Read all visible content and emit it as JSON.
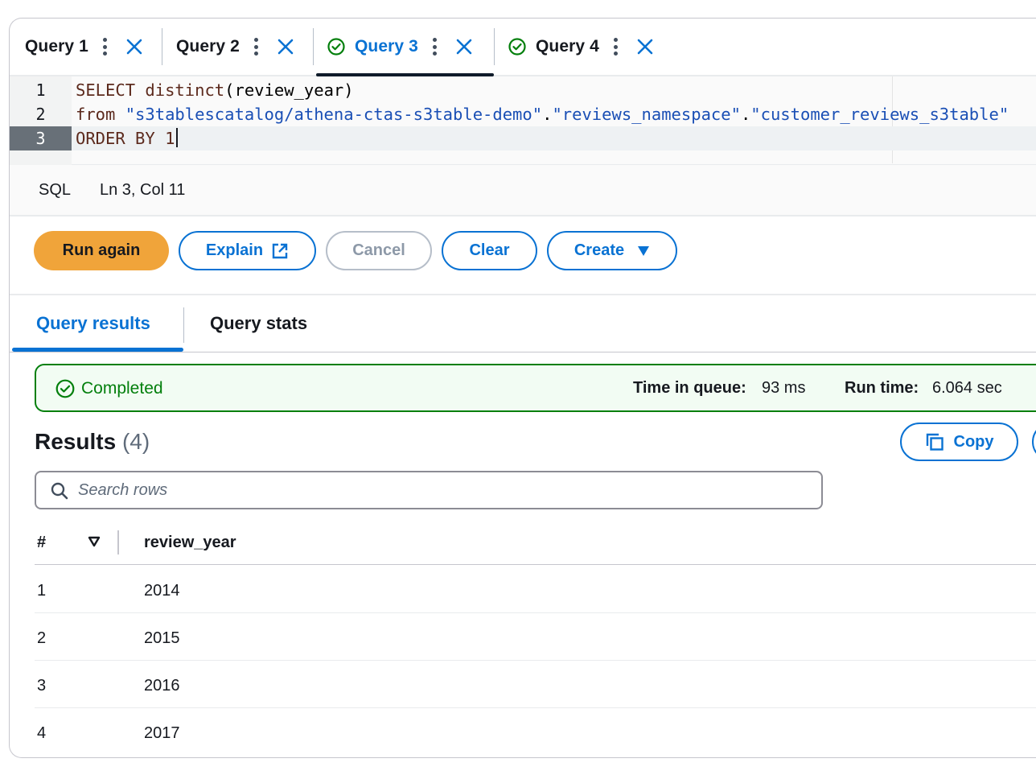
{
  "query_tabs": [
    {
      "label": "Query 1",
      "status": null,
      "active": false
    },
    {
      "label": "Query 2",
      "status": null,
      "active": false
    },
    {
      "label": "Query 3",
      "status": "success",
      "active": true
    },
    {
      "label": "Query 4",
      "status": "success",
      "active": false
    }
  ],
  "editor": {
    "lines": [
      {
        "number": "1",
        "tokens": [
          {
            "t": "SELECT ",
            "c": "kw"
          },
          {
            "t": "distinct",
            "c": "fn"
          },
          {
            "t": "(review_year)",
            "c": "pl"
          }
        ]
      },
      {
        "number": "2",
        "tokens": [
          {
            "t": "from ",
            "c": "kw"
          },
          {
            "t": "\"s3tablescatalog/athena-ctas-s3table-demo\"",
            "c": "str"
          },
          {
            "t": ".",
            "c": "pl"
          },
          {
            "t": "\"reviews_namespace\"",
            "c": "str"
          },
          {
            "t": ".",
            "c": "pl"
          },
          {
            "t": "\"customer_reviews_s3table\"",
            "c": "str"
          }
        ]
      },
      {
        "number": "3",
        "tokens": [
          {
            "t": "ORDER BY 1",
            "c": "kw"
          }
        ]
      }
    ],
    "current_line": "3"
  },
  "statusbar": {
    "language": "SQL",
    "position": "Ln 3, Col 11"
  },
  "actions": {
    "run_again": "Run again",
    "explain": "Explain",
    "cancel": "Cancel",
    "clear": "Clear",
    "create": "Create"
  },
  "result_tabs": {
    "results": "Query results",
    "stats": "Query stats"
  },
  "banner": {
    "status": "Completed",
    "time_in_queue_label": "Time in queue:",
    "time_in_queue": "93 ms",
    "run_time_label": "Run time:",
    "run_time": "6.064 sec"
  },
  "results": {
    "title": "Results",
    "count": "(4)",
    "copy_label": "Copy",
    "search_placeholder": "Search rows",
    "columns": [
      "#",
      "review_year"
    ],
    "rows": [
      {
        "index": "1",
        "review_year": "2014"
      },
      {
        "index": "2",
        "review_year": "2015"
      },
      {
        "index": "3",
        "review_year": "2016"
      },
      {
        "index": "4",
        "review_year": "2017"
      }
    ]
  },
  "colors": {
    "accent": "#0972d3",
    "primary_button": "#f0a43a",
    "success": "#037f0c",
    "disabled": "#8d99a8"
  },
  "icons": {
    "tab_status": "check-circle-icon",
    "tab_menu": "vertical-dots-icon",
    "tab_close": "close-icon",
    "explain": "external-link-icon",
    "create": "caret-down-icon",
    "copy": "copy-icon",
    "search": "search-icon",
    "sort": "sort-down-icon"
  }
}
